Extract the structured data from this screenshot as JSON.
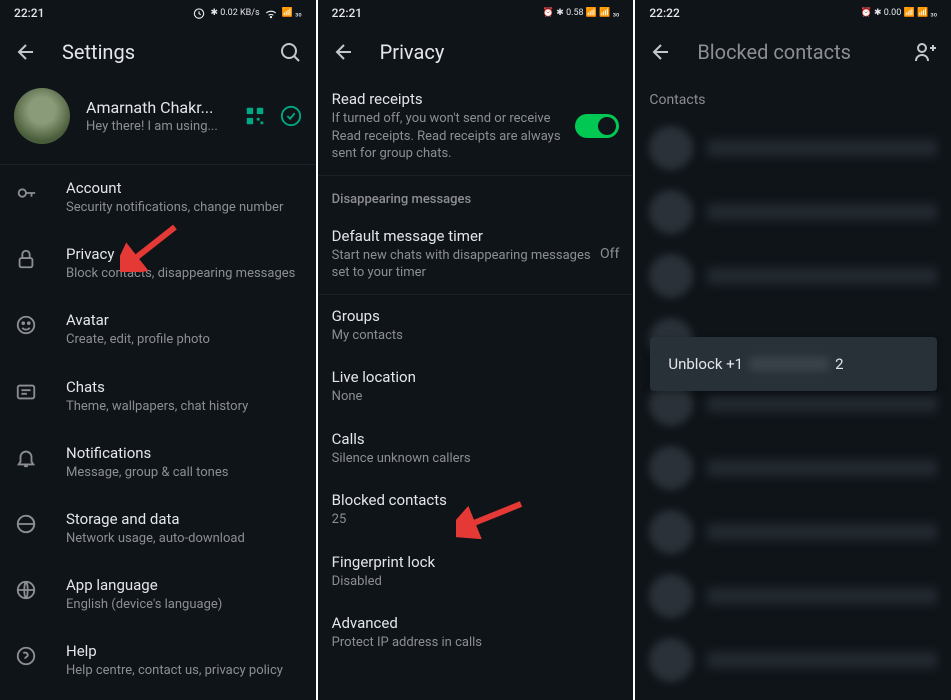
{
  "status": {
    "time1": "22:21",
    "time2": "22:21",
    "time3": "22:22",
    "icons": "⏰ ✱ 0.00 📶 📶 📶 ⚫30"
  },
  "screen1": {
    "title": "Settings",
    "profile": {
      "name": "Amarnath Chakr...",
      "status": "Hey there! I am using..."
    },
    "items": [
      {
        "title": "Account",
        "sub": "Security notifications, change number"
      },
      {
        "title": "Privacy",
        "sub": "Block contacts, disappearing messages"
      },
      {
        "title": "Avatar",
        "sub": "Create, edit, profile photo"
      },
      {
        "title": "Chats",
        "sub": "Theme, wallpapers, chat history"
      },
      {
        "title": "Notifications",
        "sub": "Message, group & call tones"
      },
      {
        "title": "Storage and data",
        "sub": "Network usage, auto-download"
      },
      {
        "title": "App language",
        "sub": "English (device's language)"
      },
      {
        "title": "Help",
        "sub": "Help centre, contact us, privacy policy"
      }
    ]
  },
  "screen2": {
    "title": "Privacy",
    "read_receipts": {
      "title": "Read receipts",
      "sub": "If turned off, you won't send or receive Read receipts. Read receipts are always sent for group chats."
    },
    "section_header": "Disappearing messages",
    "timer": {
      "title": "Default message timer",
      "sub": "Start new chats with disappearing messages set to your timer",
      "value": "Off"
    },
    "items": [
      {
        "title": "Groups",
        "sub": "My contacts"
      },
      {
        "title": "Live location",
        "sub": "None"
      },
      {
        "title": "Calls",
        "sub": "Silence unknown callers"
      },
      {
        "title": "Blocked contacts",
        "sub": "25"
      },
      {
        "title": "Fingerprint lock",
        "sub": "Disabled"
      },
      {
        "title": "Advanced",
        "sub": "Protect IP address in calls"
      }
    ]
  },
  "screen3": {
    "title": "Blocked contacts",
    "contacts_label": "Contacts",
    "unblock": {
      "prefix": "Unblock +1",
      "suffix": "2"
    }
  }
}
